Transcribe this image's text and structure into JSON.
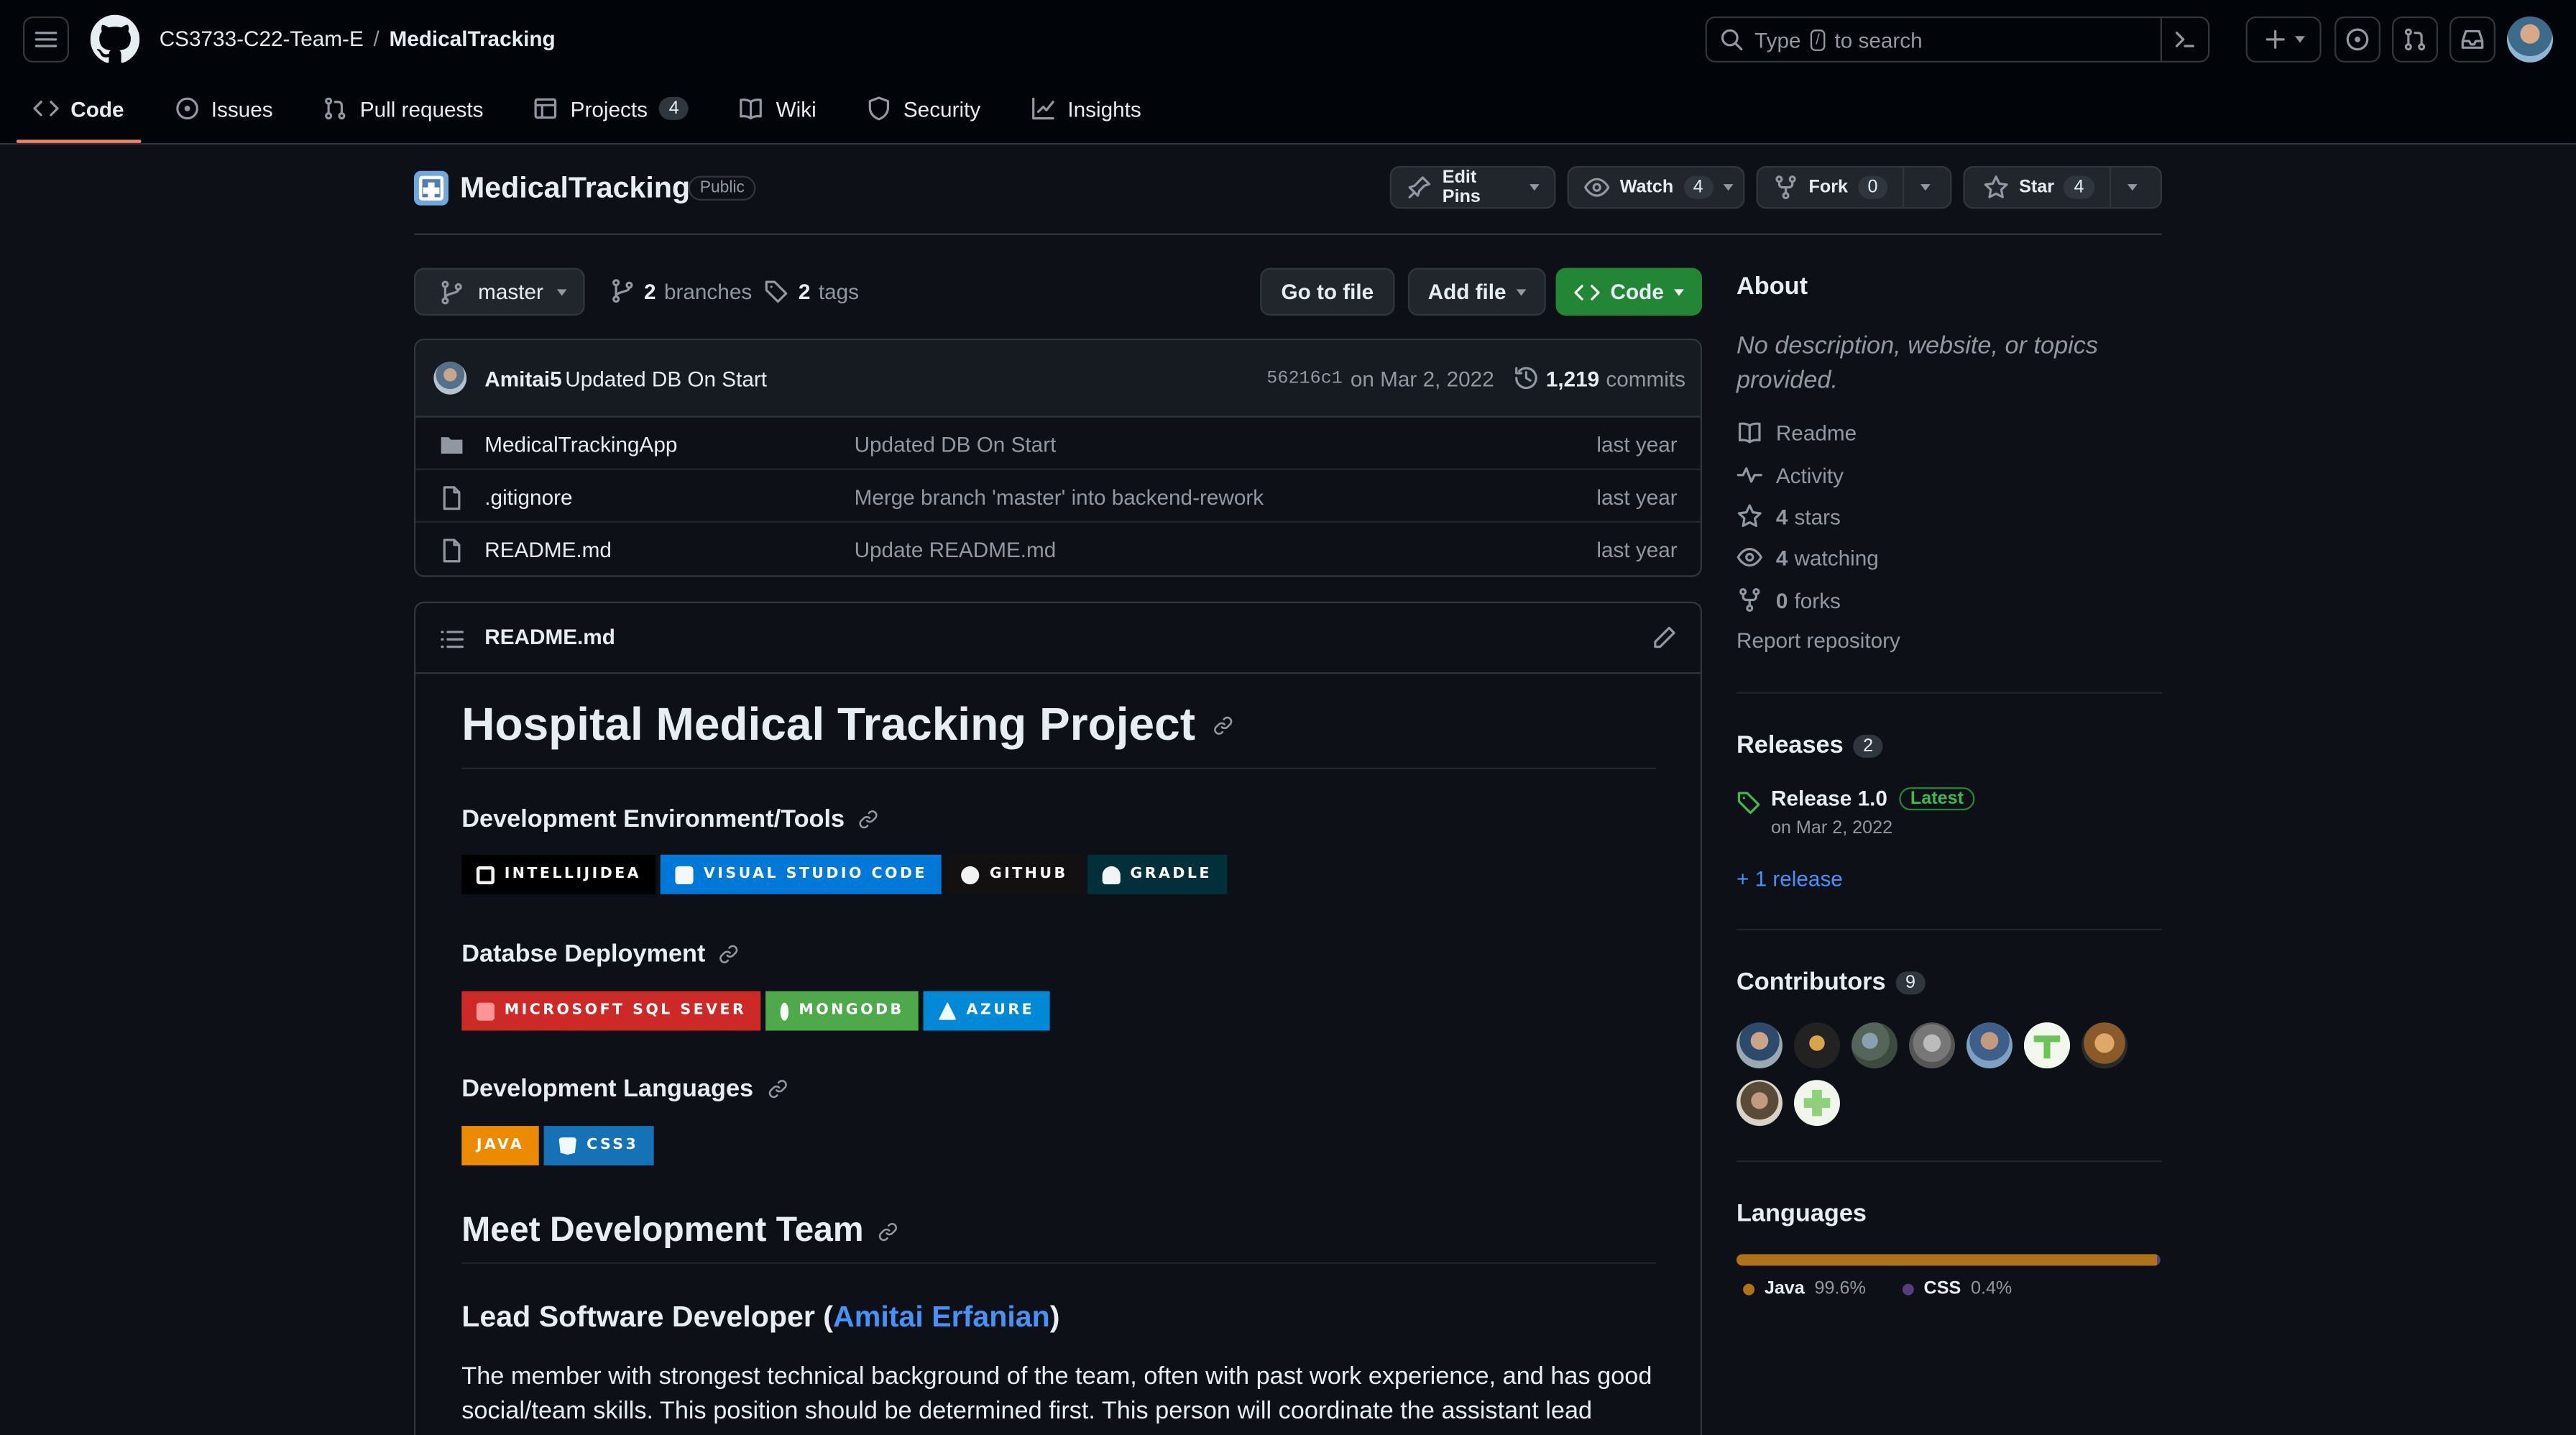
{
  "header": {
    "owner": "CS3733-C22-Team-E",
    "separator": "/",
    "repo": "MedicalTracking",
    "search_prefix": "Type",
    "search_slash": "/",
    "search_suffix": "to search"
  },
  "tabs": [
    {
      "label": "Code",
      "icon": "code-icon",
      "selected": true
    },
    {
      "label": "Issues",
      "icon": "issue-icon"
    },
    {
      "label": "Pull requests",
      "icon": "pull-request-icon"
    },
    {
      "label": "Projects",
      "icon": "table-icon",
      "count": "4"
    },
    {
      "label": "Wiki",
      "icon": "book-icon"
    },
    {
      "label": "Security",
      "icon": "shield-icon"
    },
    {
      "label": "Insights",
      "icon": "graph-icon"
    }
  ],
  "repo": {
    "name": "MedicalTracking",
    "visibility": "Public",
    "edit_pins": "Edit Pins",
    "watch": "Watch",
    "watch_count": "4",
    "fork": "Fork",
    "fork_count": "0",
    "star": "Star",
    "star_count": "4"
  },
  "branch_bar": {
    "branch": "master",
    "branches_count": "2",
    "branches_label": "branches",
    "tags_count": "2",
    "tags_label": "tags",
    "go_to_file": "Go to file",
    "add_file": "Add file",
    "code": "Code"
  },
  "commit": {
    "author": "Amitai5",
    "message": "Updated DB On Start",
    "sha": "56216c1",
    "date": "on Mar 2, 2022",
    "commits_count": "1,219",
    "commits_label": "commits"
  },
  "files": [
    {
      "name": "MedicalTrackingApp",
      "type": "folder",
      "message": "Updated DB On Start",
      "age": "last year"
    },
    {
      "name": ".gitignore",
      "type": "file",
      "message": "Merge branch 'master' into backend-rework",
      "age": "last year"
    },
    {
      "name": "README.md",
      "type": "file",
      "message": "Update README.md",
      "age": "last year"
    }
  ],
  "readme": {
    "filename": "README.md",
    "title": "Hospital Medical Tracking Project",
    "section1": "Development Environment/Tools",
    "badges1": [
      {
        "label": "INTELLIJIDEA",
        "color": "#000000"
      },
      {
        "label": "VISUAL STUDIO CODE",
        "color": "#0078d7"
      },
      {
        "label": "GITHUB",
        "color": "#121011"
      },
      {
        "label": "GRADLE",
        "color": "#02303a"
      }
    ],
    "section2": "Databse Deployment",
    "badges2": [
      {
        "label": "MICROSOFT SQL SEVER",
        "color": "#cc2927"
      },
      {
        "label": "MONGODB",
        "color": "#4ea94b"
      },
      {
        "label": "AZURE",
        "color": "#0089d6"
      }
    ],
    "section3": "Development Languages",
    "badges3": [
      {
        "label": "JAVA",
        "color": "#ed8b00"
      },
      {
        "label": "CSS3",
        "color": "#1572b6"
      }
    ],
    "team_heading": "Meet Development Team",
    "lead_prefix": "Lead Software Developer (",
    "lead_name": "Amitai Erfanian",
    "lead_suffix": ")",
    "paragraph": "The member with strongest technical background of the team, often with past work experience, and has good social/team skills. This position should be determined first. This person will coordinate the assistant lead software"
  },
  "sidebar": {
    "about_title": "About",
    "about_desc": "No description, website, or topics provided.",
    "readme": "Readme",
    "activity": "Activity",
    "stars_count": "4",
    "stars_label": "stars",
    "watching_count": "4",
    "watching_label": "watching",
    "forks_count": "0",
    "forks_label": "forks",
    "report": "Report repository",
    "releases_title": "Releases",
    "releases_count": "2",
    "release_name": "Release 1.0",
    "release_badge": "Latest",
    "release_date": "on Mar 2, 2022",
    "more_releases": "+ 1 release",
    "contributors_title": "Contributors",
    "contributors_count": "9",
    "languages_title": "Languages",
    "languages": [
      {
        "name": "Java",
        "percent": "99.6%",
        "color": "#b07219"
      },
      {
        "name": "CSS",
        "percent": "0.4%",
        "color": "#563d7c"
      }
    ]
  }
}
